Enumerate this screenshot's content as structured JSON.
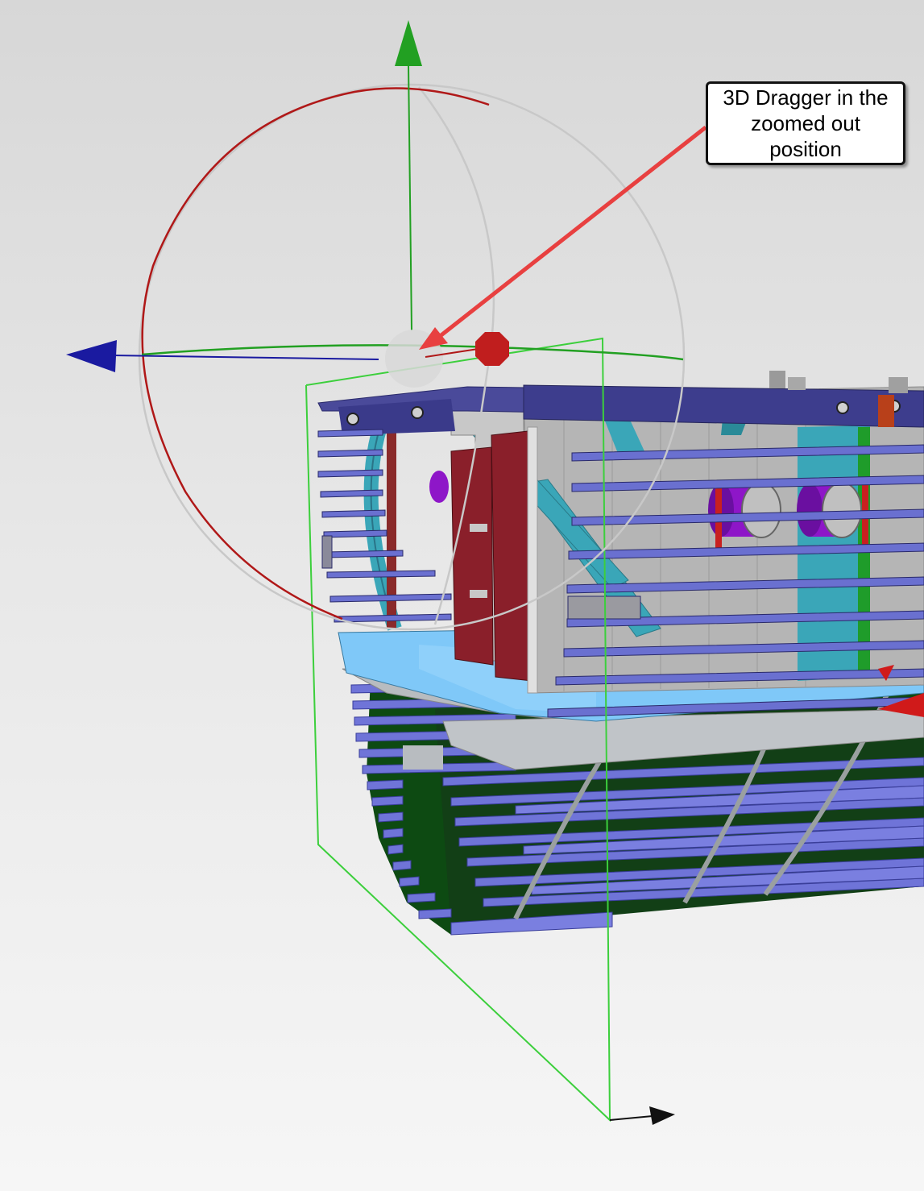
{
  "callout": {
    "text": "3D Dragger in the zoomed out position"
  },
  "colors": {
    "x_axis": "#1a1aa0",
    "y_axis": "#22a022",
    "z_axis": "#111111",
    "rotation_ring_red": "#b01818",
    "rotation_ring_gray": "#c8c8c8",
    "center_handle": "#d8d8d8",
    "red_handle": "#c01e1e",
    "bounding_box": "#3ccf3c",
    "arrow": "#e84040",
    "model_blue_fins": "#6f74d8",
    "model_dark_green": "#0d4a12",
    "model_teal": "#3aa6b8",
    "model_navy": "#3a3a8a",
    "model_gray": "#b8b8b8",
    "model_maroon": "#8a1f2a",
    "model_purple": "#8e16c8",
    "model_light_blue": "#7fc8f8"
  },
  "icons": {
    "x_axis_arrow": "arrow-left-icon",
    "y_axis_arrow": "arrow-up-icon",
    "z_axis_arrow": "arrow-right-icon",
    "center_handle": "sphere-handle-icon",
    "red_handle": "octagon-handle-icon"
  }
}
